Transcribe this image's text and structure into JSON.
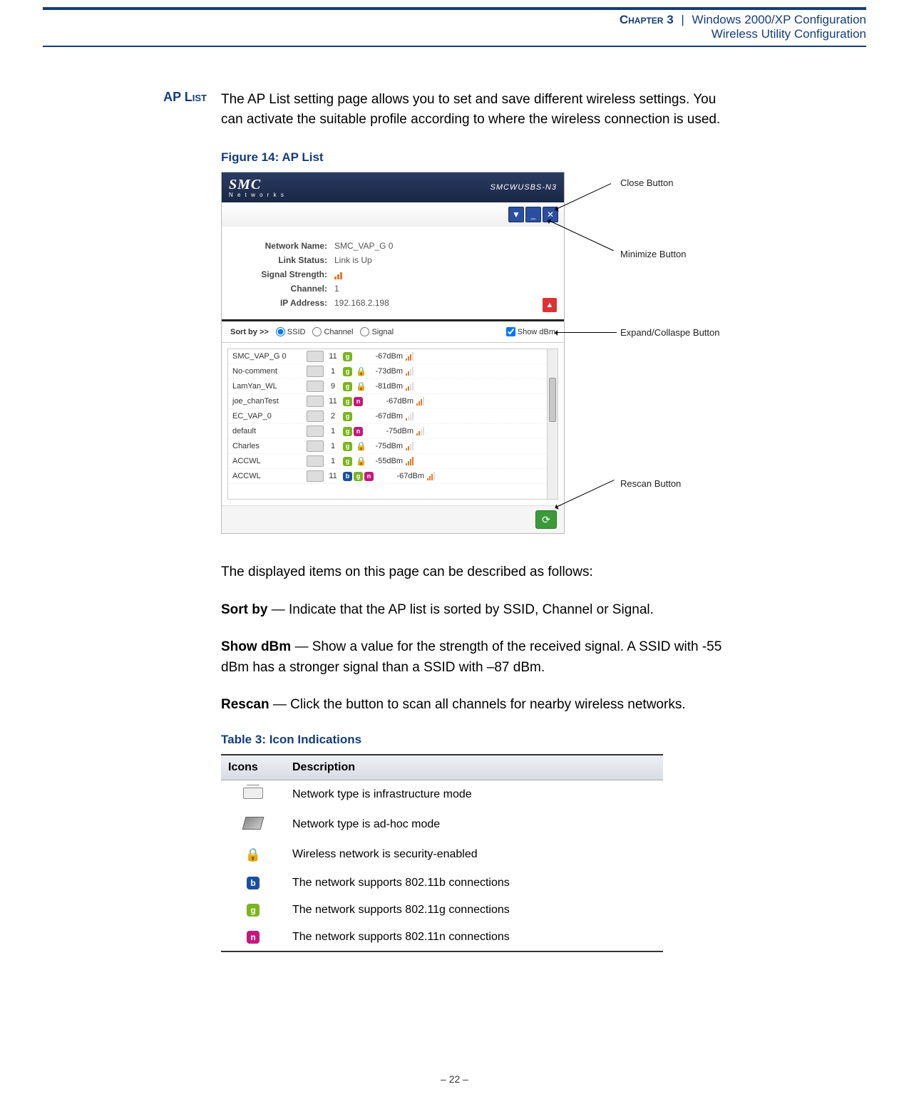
{
  "header": {
    "chapter": "Chapter 3",
    "separator": "|",
    "title1": "Windows 2000/XP Configuration",
    "title2": "Wireless Utility Configuration"
  },
  "section": {
    "label": "AP List"
  },
  "intro": "The AP List setting page allows you to set and save different wireless settings. You can activate the suitable profile according to where the wireless connection is used.",
  "figure": {
    "caption": "Figure 14:  AP List",
    "brand": "SMC",
    "brand_sub": "N e t w o r k s",
    "model": "SMCWUSBS-N3",
    "info": {
      "network_name_label": "Network Name:",
      "network_name": "SMC_VAP_G 0",
      "link_status_label": "Link Status:",
      "link_status": "Link is Up",
      "signal_label": "Signal Strength:",
      "channel_label": "Channel:",
      "channel": "1",
      "ip_label": "IP Address:",
      "ip": "192.168.2.198"
    },
    "sort": {
      "label": "Sort by >>",
      "opt_ssid": "SSID",
      "opt_channel": "Channel",
      "opt_signal": "Signal",
      "show_dbm": "Show dBm"
    },
    "aps": [
      {
        "ssid": "ACCWL",
        "ch": "11",
        "badges": [
          "b",
          "g",
          "n"
        ],
        "lock": false,
        "dbm": "-67dBm",
        "sig": 3
      },
      {
        "ssid": "ACCWL",
        "ch": "1",
        "badges": [
          "g"
        ],
        "lock": true,
        "dbm": "-55dBm",
        "sig": 4
      },
      {
        "ssid": "Charles",
        "ch": "1",
        "badges": [
          "g"
        ],
        "lock": true,
        "dbm": "-75dBm",
        "sig": 2
      },
      {
        "ssid": "default",
        "ch": "1",
        "badges": [
          "g",
          "n"
        ],
        "lock": false,
        "dbm": "-75dBm",
        "sig": 2
      },
      {
        "ssid": "EC_VAP_0",
        "ch": "2",
        "badges": [
          "g"
        ],
        "lock": false,
        "dbm": "-67dBm",
        "sig": 1
      },
      {
        "ssid": "joe_chanTest",
        "ch": "11",
        "badges": [
          "g",
          "n"
        ],
        "lock": false,
        "dbm": "-67dBm",
        "sig": 3
      },
      {
        "ssid": "LamYan_WL",
        "ch": "9",
        "badges": [
          "g"
        ],
        "lock": true,
        "dbm": "-81dBm",
        "sig": 2
      },
      {
        "ssid": "No-comment",
        "ch": "1",
        "badges": [
          "g"
        ],
        "lock": true,
        "dbm": "-73dBm",
        "sig": 2
      },
      {
        "ssid": "SMC_VAP_G 0",
        "ch": "11",
        "badges": [
          "g"
        ],
        "lock": false,
        "dbm": "-67dBm",
        "sig": 3
      }
    ],
    "callouts": {
      "close": "Close Button",
      "minimize": "Minimize Button",
      "expand": "Expand/Collaspe Button",
      "rescan": "Rescan Button"
    }
  },
  "desc": {
    "lead": "The displayed items on this page can be described as follows:",
    "sortby_b": "Sort by",
    "sortby_t": " — Indicate that the AP list is sorted by SSID, Channel or Signal.",
    "showdbm_b": "Show dBm",
    "showdbm_t": " — Show a value for the strength of the received signal. A SSID with -55 dBm has a stronger signal than a SSID with –87 dBm.",
    "rescan_b": "Rescan",
    "rescan_t": " — Click the button to scan all channels for nearby wireless networks."
  },
  "table": {
    "caption": "Table 3: Icon Indications",
    "h_icons": "Icons",
    "h_desc": "Description",
    "rows": [
      {
        "icon": "infra",
        "text": "Network type is infrastructure mode"
      },
      {
        "icon": "adhoc",
        "text": "Network type is ad-hoc mode"
      },
      {
        "icon": "lock",
        "text": "Wireless network is security-enabled"
      },
      {
        "icon": "b",
        "text": "The network supports 802.11b connections"
      },
      {
        "icon": "g",
        "text": "The network supports 802.11g connections"
      },
      {
        "icon": "n",
        "text": "The network supports 802.11n connections"
      }
    ]
  },
  "footer": "–  22  –"
}
